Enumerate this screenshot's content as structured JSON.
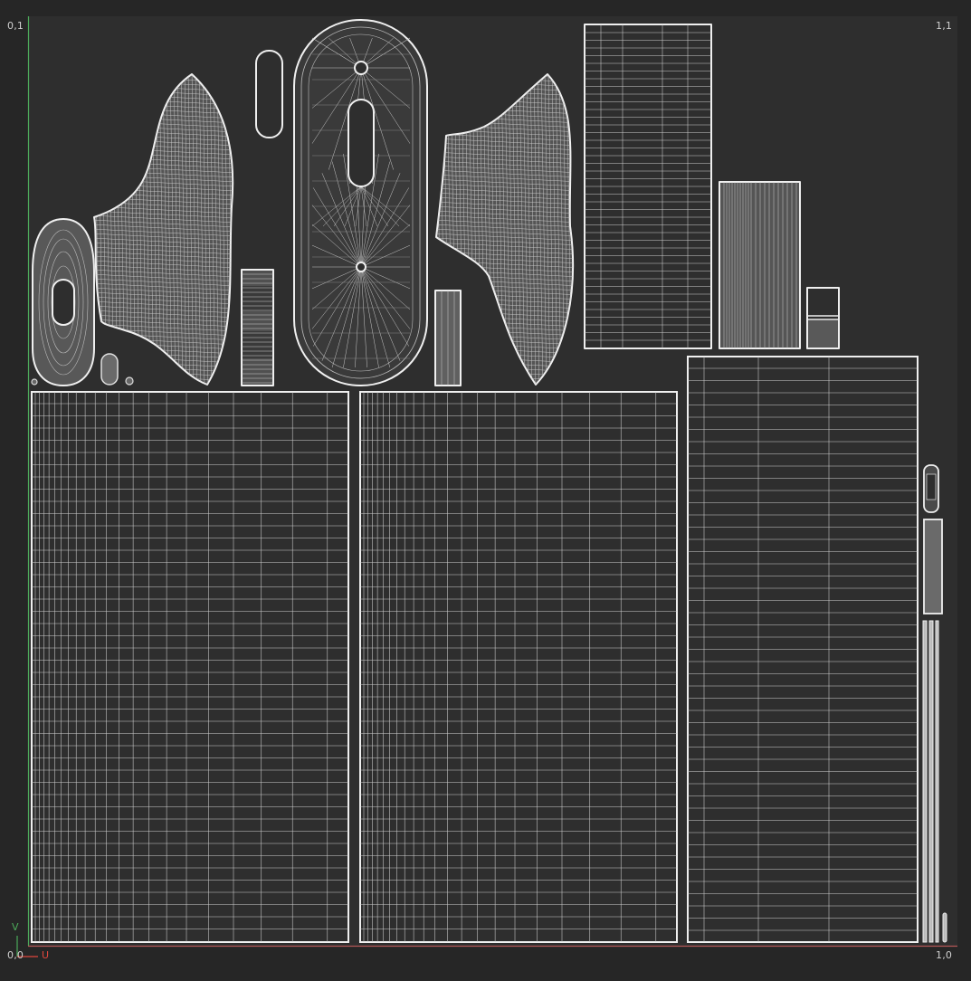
{
  "uv_editor": {
    "corner_labels": {
      "top_left": "0,1",
      "top_right": "1,1",
      "bottom_left": "0,0",
      "bottom_right": "1,0"
    },
    "axis_labels": {
      "u": "U",
      "v": "V"
    },
    "colors": {
      "background": "#262626",
      "canvas": "#2e2e2e",
      "wire": "#d2d2d2",
      "outline": "#f0f0f0",
      "u_axis": "#e0473c",
      "v_axis": "#4caa5a"
    }
  }
}
